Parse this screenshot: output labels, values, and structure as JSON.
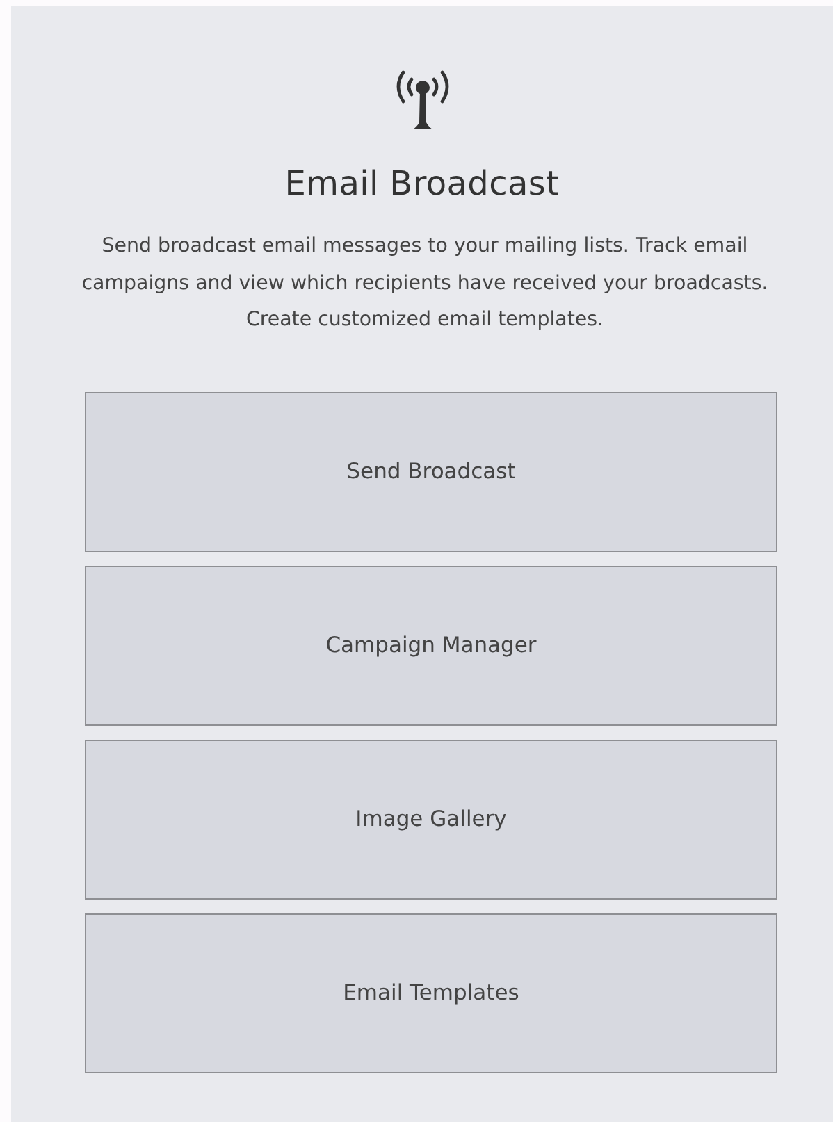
{
  "header": {
    "title": "Email Broadcast",
    "description": "Send broadcast email messages to your mailing lists. Track email campaigns and view which recipients have received your broadcasts. Create customized email templates."
  },
  "actions": [
    {
      "label": "Send Broadcast"
    },
    {
      "label": "Campaign Manager"
    },
    {
      "label": "Image Gallery"
    },
    {
      "label": "Email Templates"
    }
  ]
}
